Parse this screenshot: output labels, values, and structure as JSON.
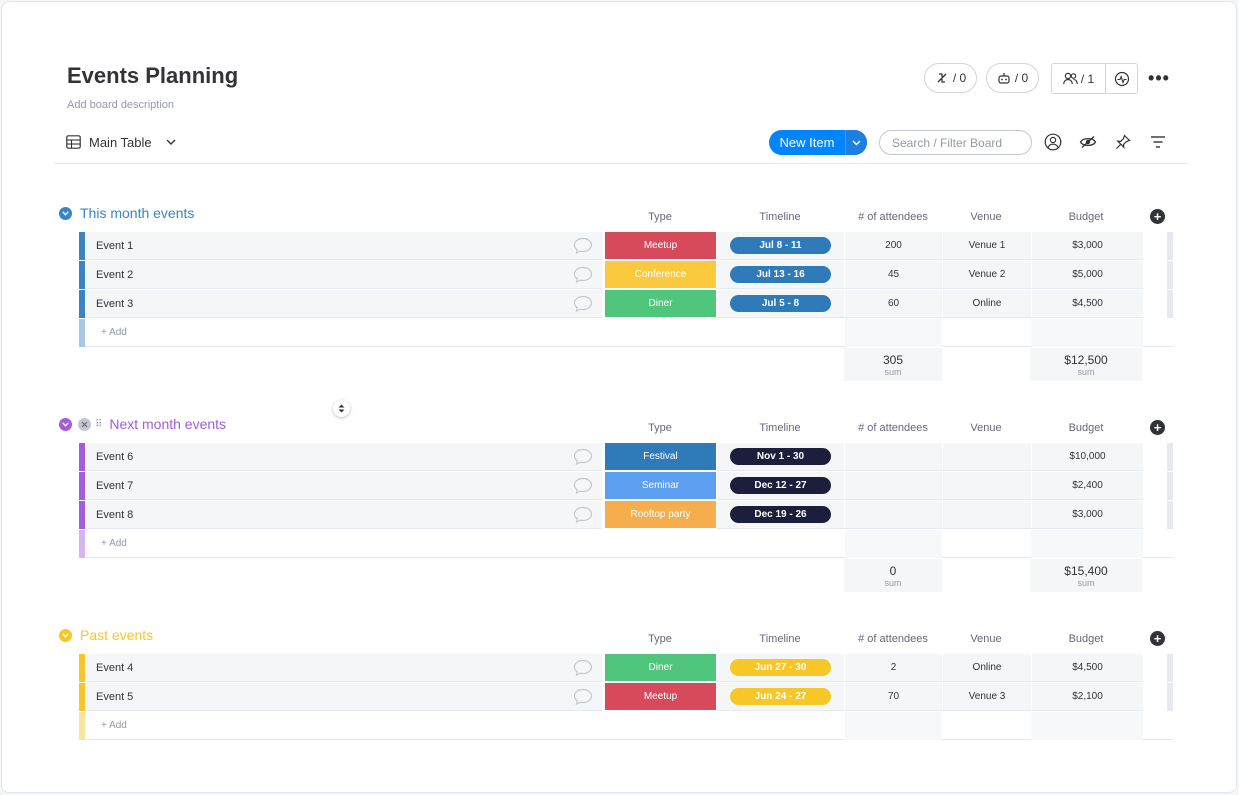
{
  "board": {
    "title": "Events Planning",
    "description": "Add board description",
    "integrations_count": "/ 0",
    "automations_count": "/ 0",
    "members_count": "/ 1"
  },
  "toolbar": {
    "view_label": "Main Table",
    "new_item_label": "New Item",
    "search_placeholder": "Search / Filter Board"
  },
  "columns": [
    "Type",
    "Timeline",
    "# of attendees",
    "Venue",
    "Budget"
  ],
  "add_row_label": "+ Add",
  "sum_label": "sum",
  "colors": {
    "accent": "#0085ff",
    "this_month": "#037f4c",
    "group_blue": "#2f7ab8",
    "group_purple": "#a25ddc",
    "group_yellow": "#f7c627",
    "meetup": "#d64a5c",
    "conference": "#fbc93d",
    "diner": "#4fc67c",
    "festival": "#2f7ab8",
    "seminar": "#5c9ef0",
    "rooftop": "#f6ad4e",
    "timeline_blue": "#2f7ab8",
    "timeline_dark": "#1c1f3b",
    "timeline_yellow": "#f7c627"
  },
  "groups": [
    {
      "title": "This month events",
      "color": "#3b84c3",
      "rows": [
        {
          "name": "Event 1",
          "type": "Meetup",
          "type_color": "#d64a5c",
          "timeline": "Jul 8 - 11",
          "tl_color": "#2f7ab8",
          "attendees": "200",
          "venue": "Venue 1",
          "budget": "$3,000"
        },
        {
          "name": "Event 2",
          "type": "Conference",
          "type_color": "#fbc93d",
          "timeline": "Jul 13 - 16",
          "tl_color": "#2f7ab8",
          "attendees": "45",
          "venue": "Venue 2",
          "budget": "$5,000"
        },
        {
          "name": "Event 3",
          "type": "Diner",
          "type_color": "#4fc67c",
          "timeline": "Jul 5 - 8",
          "tl_color": "#2f7ab8",
          "attendees": "60",
          "venue": "Online",
          "budget": "$4,500"
        }
      ],
      "sum_attendees": "305",
      "sum_budget": "$12,500"
    },
    {
      "title": "Next month events",
      "color": "#a25ddc",
      "rows": [
        {
          "name": "Event 6",
          "type": "Festival",
          "type_color": "#2f7ab8",
          "timeline": "Nov 1 - 30",
          "tl_color": "#1c1f3b",
          "attendees": "",
          "venue": "",
          "budget": "$10,000"
        },
        {
          "name": "Event 7",
          "type": "Seminar",
          "type_color": "#5c9ef0",
          "timeline": "Dec 12 - 27",
          "tl_color": "#1c1f3b",
          "attendees": "",
          "venue": "",
          "budget": "$2,400"
        },
        {
          "name": "Event 8",
          "type": "Rooftop party",
          "type_color": "#f6ad4e",
          "timeline": "Dec 19 - 26",
          "tl_color": "#1c1f3b",
          "attendees": "",
          "venue": "",
          "budget": "$3,000"
        }
      ],
      "sum_attendees": "0",
      "sum_budget": "$15,400"
    },
    {
      "title": "Past events",
      "color": "#f7c627",
      "rows": [
        {
          "name": "Event 4",
          "type": "Diner",
          "type_color": "#4fc67c",
          "timeline": "Jun 27 - 30",
          "tl_color": "#f7c627",
          "attendees": "2",
          "venue": "Online",
          "budget": "$4,500"
        },
        {
          "name": "Event 5",
          "type": "Meetup",
          "type_color": "#d64a5c",
          "timeline": "Jun 24 - 27",
          "tl_color": "#f7c627",
          "attendees": "70",
          "venue": "Venue 3",
          "budget": "$2,100"
        }
      ]
    }
  ]
}
